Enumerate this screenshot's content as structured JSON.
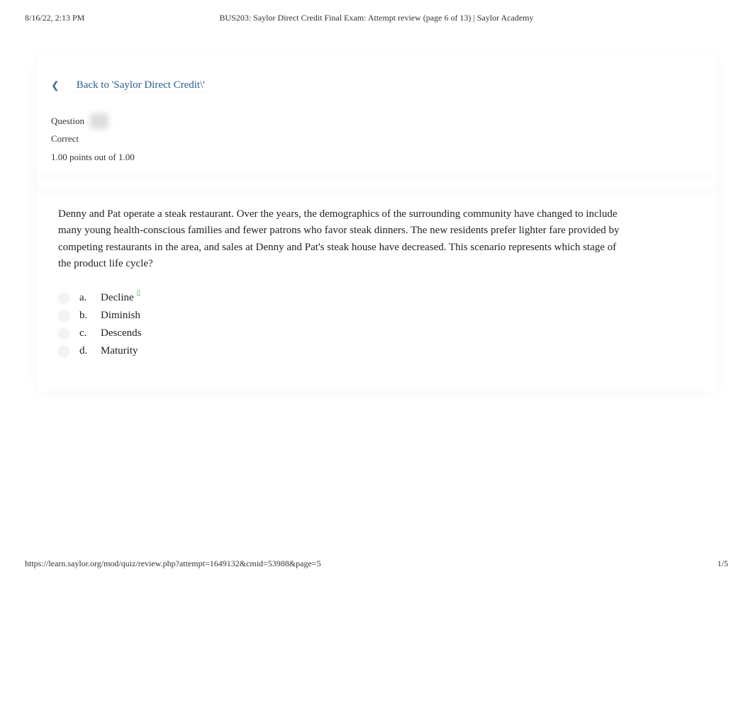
{
  "header": {
    "datetime": "8/16/22, 2:13 PM",
    "title": "BUS203: Saylor Direct Credit Final Exam: Attempt review (page 6 of 13) | Saylor Academy"
  },
  "back_link": {
    "icon_glyph": "❮",
    "text": "Back to 'Saylor Direct Credit\\'"
  },
  "question_meta": {
    "question_label": "Question",
    "status": "Correct",
    "points": "1.00 points out of 1.00"
  },
  "question": {
    "text": "Denny and Pat operate a steak restaurant. Over the years, the demographics of the surrounding community have changed to include many young health-conscious families and fewer patrons who favor steak dinners. The new residents prefer lighter fare provided by competing restaurants in the area, and sales at Denny and Pat's steak house have decreased. This scenario represents which stage of the product life cycle?",
    "options": [
      {
        "letter": "a.",
        "text": "Decline",
        "correct": true
      },
      {
        "letter": "b.",
        "text": "Diminish",
        "correct": false
      },
      {
        "letter": "c.",
        "text": "Descends",
        "correct": false
      },
      {
        "letter": "d.",
        "text": "Maturity",
        "correct": false
      }
    ]
  },
  "footer": {
    "url": "https://learn.saylor.org/mod/quiz/review.php?attempt=1649132&cmid=53988&page=5",
    "pages": "1/5"
  },
  "correct_glyph": "▯"
}
